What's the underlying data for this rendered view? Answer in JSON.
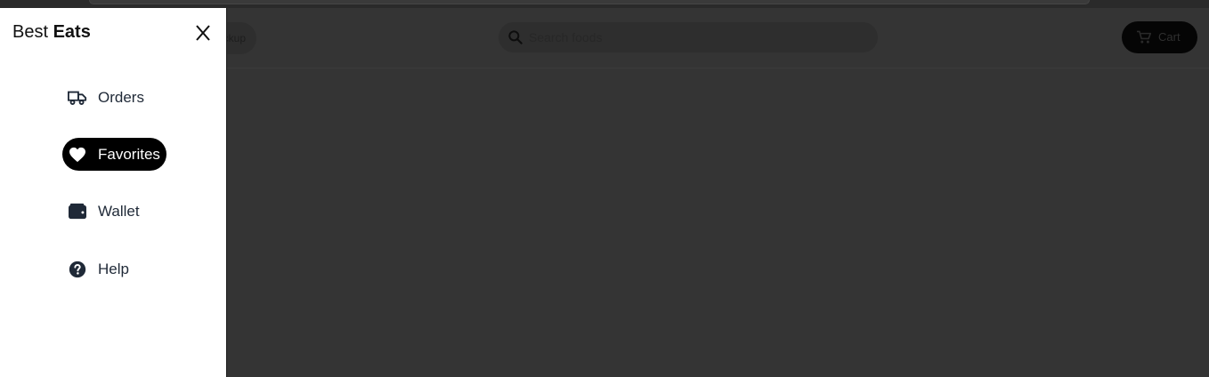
{
  "brand": {
    "first": "Best",
    "second": "Eats"
  },
  "nav": {
    "items": [
      {
        "label": "Orders",
        "icon": "truck-icon"
      },
      {
        "label": "Favorites",
        "icon": "heart-icon",
        "active": true
      },
      {
        "label": "Wallet",
        "icon": "wallet-icon"
      },
      {
        "label": "Help",
        "icon": "help-circle-icon"
      }
    ]
  },
  "header": {
    "pickup_label": "ckup",
    "search_placeholder": "Search foods",
    "cart_label": "Cart"
  },
  "colors": {
    "overlay": "#343434",
    "drawer_bg": "#ffffff",
    "active_pill": "#000000"
  }
}
